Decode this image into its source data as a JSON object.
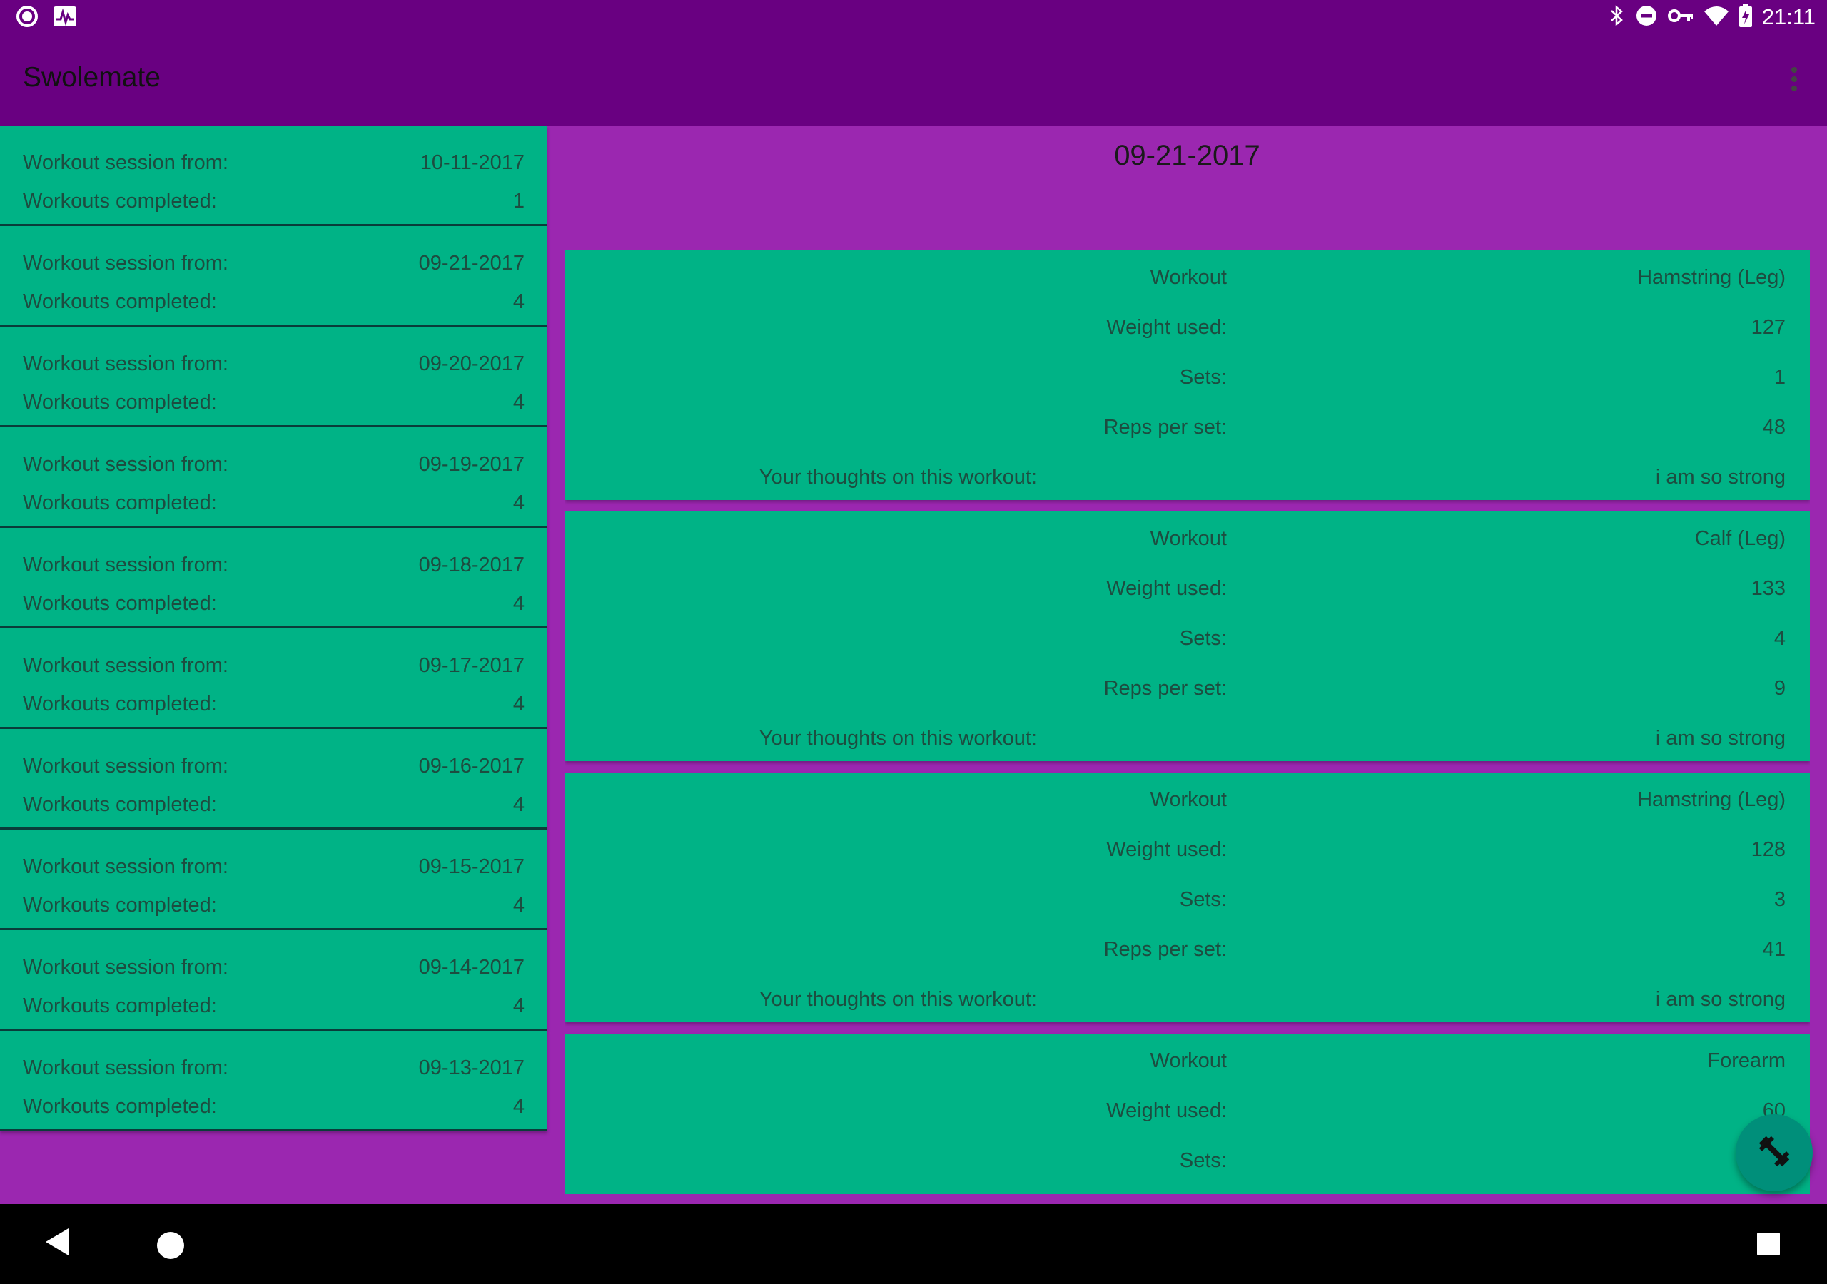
{
  "status_bar": {
    "time": "21:11",
    "left_icons": [
      "circle-notification-icon",
      "pulse-image-icon"
    ],
    "right_icons": [
      "bluetooth-icon",
      "do-not-disturb-icon",
      "vpn-key-icon",
      "wifi-icon",
      "battery-charging-icon"
    ]
  },
  "app_bar": {
    "title": "Swolemate",
    "overflow_icon": "more-vert-icon"
  },
  "colors": {
    "primary_dark": "#690081",
    "background": "#9b27b0",
    "card": "#00b386",
    "fab": "#008f7a"
  },
  "sessions": [
    {
      "label": "Workout session from:",
      "date": "10-11-2017",
      "completed_label": "Workouts completed:",
      "completed": "1"
    },
    {
      "label": "Workout session from:",
      "date": "09-21-2017",
      "completed_label": "Workouts completed:",
      "completed": "4"
    },
    {
      "label": "Workout session from:",
      "date": "09-20-2017",
      "completed_label": "Workouts completed:",
      "completed": "4"
    },
    {
      "label": "Workout session from:",
      "date": "09-19-2017",
      "completed_label": "Workouts completed:",
      "completed": "4"
    },
    {
      "label": "Workout session from:",
      "date": "09-18-2017",
      "completed_label": "Workouts completed:",
      "completed": "4"
    },
    {
      "label": "Workout session from:",
      "date": "09-17-2017",
      "completed_label": "Workouts completed:",
      "completed": "4"
    },
    {
      "label": "Workout session from:",
      "date": "09-16-2017",
      "completed_label": "Workouts completed:",
      "completed": "4"
    },
    {
      "label": "Workout session from:",
      "date": "09-15-2017",
      "completed_label": "Workouts completed:",
      "completed": "4"
    },
    {
      "label": "Workout session from:",
      "date": "09-14-2017",
      "completed_label": "Workouts completed:",
      "completed": "4"
    },
    {
      "label": "Workout session from:",
      "date": "09-13-2017",
      "completed_label": "Workouts completed:",
      "completed": "4"
    }
  ],
  "detail": {
    "date": "09-21-2017",
    "labels": {
      "workout": "Workout",
      "weight": "Weight used:",
      "sets": "Sets:",
      "reps": "Reps per set:",
      "thoughts": "Your thoughts on this workout:"
    },
    "workouts": [
      {
        "name": "Hamstring (Leg)",
        "weight": "127",
        "sets": "1",
        "reps": "48",
        "thoughts": "i am so strong"
      },
      {
        "name": "Calf (Leg)",
        "weight": "133",
        "sets": "4",
        "reps": "9",
        "thoughts": "i am so strong"
      },
      {
        "name": "Hamstring (Leg)",
        "weight": "128",
        "sets": "3",
        "reps": "41",
        "thoughts": "i am so strong"
      },
      {
        "name": "Forearm",
        "weight": "60",
        "sets": "",
        "reps": "",
        "thoughts": ""
      }
    ]
  },
  "fab": {
    "icon": "dumbbell-icon"
  },
  "nav_bar": {
    "icons": [
      "back-icon",
      "home-icon",
      "recents-icon"
    ]
  }
}
